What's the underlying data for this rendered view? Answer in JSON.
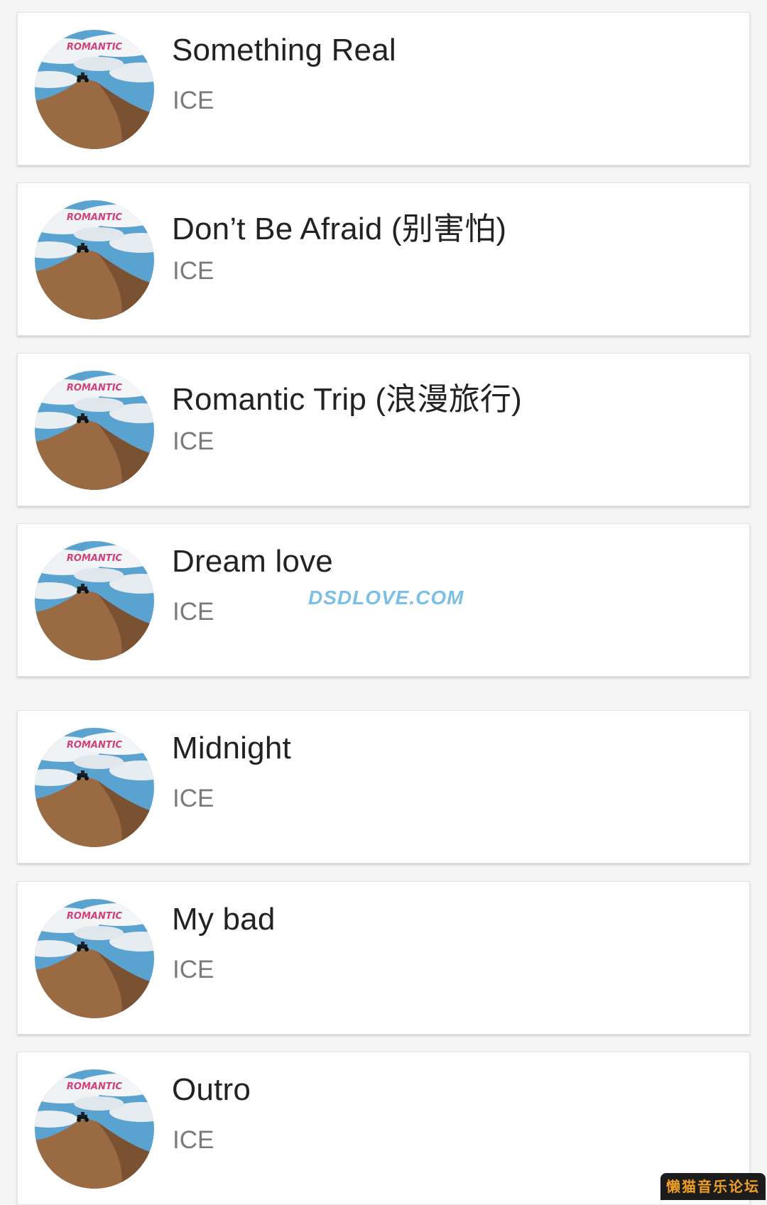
{
  "album": {
    "cover_label": "ROMANTIC",
    "colors": {
      "sky": "#5aa2cf",
      "cloud": "#eef2f5",
      "dune": "#9a6b42",
      "dune_shadow": "#7a5232",
      "label": "#d0407a"
    }
  },
  "tracks": [
    {
      "title": "Something Real",
      "artist": "ICE"
    },
    {
      "title": "Don’t Be Afraid (别害怕)",
      "artist": "ICE"
    },
    {
      "title": "Romantic Trip (浪漫旅行)",
      "artist": "ICE"
    },
    {
      "title": "Dream love",
      "artist": "ICE"
    },
    {
      "title": "Midnight",
      "artist": "ICE"
    },
    {
      "title": "My bad",
      "artist": "ICE"
    },
    {
      "title": "Outro",
      "artist": "ICE"
    }
  ],
  "watermark": {
    "text": "DSDLOVE.COM"
  },
  "forum_badge": {
    "text": "懒猫音乐论坛"
  }
}
